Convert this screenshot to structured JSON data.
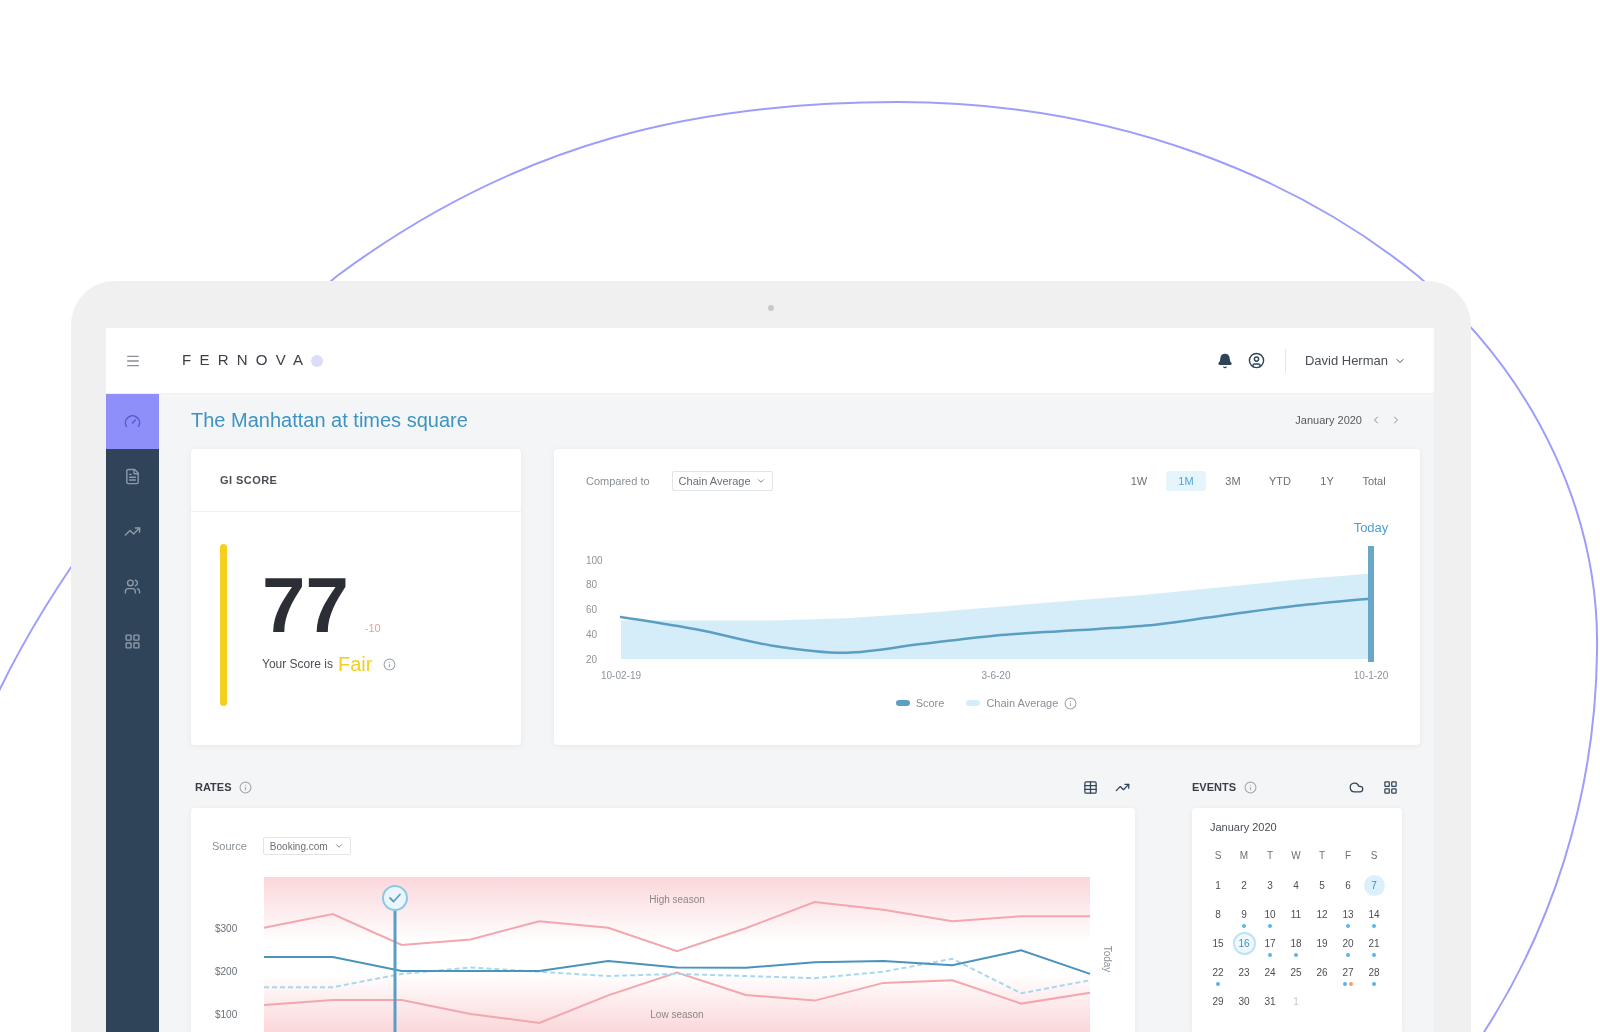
{
  "header": {
    "logo": "FERNOVA",
    "user_name": "David Herman"
  },
  "sidebar": {
    "items": [
      {
        "selected": true
      },
      {
        "selected": false
      },
      {
        "selected": false
      },
      {
        "selected": false
      },
      {
        "selected": false
      }
    ]
  },
  "page": {
    "title": "The Manhattan at times square",
    "period": "January 2020"
  },
  "score_card": {
    "title": "GI SCORE",
    "score": "77",
    "change": "-10",
    "negative": true,
    "caption": "Your Score is",
    "rating": "Fair",
    "color": "#f5cf1f"
  },
  "trend_chart": {
    "compare_label": "Compared to",
    "compare_value": "Chain Average",
    "ranges": [
      {
        "label": "1W",
        "selected": false
      },
      {
        "label": "1M",
        "selected": true
      },
      {
        "label": "3M",
        "selected": false
      },
      {
        "label": "YTD",
        "selected": false
      },
      {
        "label": "1Y",
        "selected": false
      },
      {
        "label": "Total",
        "selected": false
      }
    ],
    "chart_data": {
      "type": "area",
      "categories": [
        "10-02-19",
        null,
        null,
        null,
        null,
        "3-6-20",
        null,
        null,
        null,
        null,
        "10-1-20"
      ],
      "ylim": [
        20,
        100
      ],
      "yticks": [
        {
          "value": 20,
          "label": "20"
        },
        {
          "value": 40,
          "label": "40"
        },
        {
          "value": 60,
          "label": "60"
        },
        {
          "value": 80,
          "label": "80"
        },
        {
          "value": 100,
          "label": "100"
        }
      ],
      "series": [
        {
          "name": "Score",
          "type": "line",
          "color": "#5b9ec3",
          "values": [
            54,
            44,
            31,
            25,
            32,
            39,
            43,
            47,
            55,
            63,
            69
          ]
        },
        {
          "name": "Chain Average",
          "color": "#d4edf9",
          "values": [
            51,
            51,
            51,
            53,
            57,
            62,
            67,
            72,
            78,
            84,
            89
          ]
        }
      ],
      "ref_lines": [
        {
          "axis": "x",
          "value": "10-1-20",
          "label": "Today"
        }
      ]
    }
  },
  "rates": {
    "title": "RATES",
    "source_label": "Source",
    "source_value": "Booking.com",
    "chart_data": {
      "type": "line",
      "ylim": [
        60,
        420
      ],
      "yticks": [
        {
          "value": 100,
          "label": "$100"
        },
        {
          "value": 200,
          "label": "$200"
        },
        {
          "value": 300,
          "label": "$300"
        }
      ],
      "series": [
        {
          "color": "#f3a6ad",
          "values": [
            302,
            334,
            262,
            275,
            317,
            302,
            248,
            301,
            362,
            344,
            317,
            329,
            329
          ]
        },
        {
          "color": "#f3a6ad",
          "values": [
            123,
            134,
            134,
            102,
            81,
            145,
            198,
            146,
            133,
            174,
            180,
            126,
            151
          ]
        },
        {
          "color": "#a9d8ee",
          "line_style": "dashed",
          "values": [
            164,
            164,
            195,
            210,
            200,
            190,
            195,
            190,
            185,
            200,
            230,
            150,
            180
          ]
        },
        {
          "color": "#4a93ba",
          "values": [
            234,
            234,
            202,
            202,
            202,
            225,
            210,
            209,
            222,
            225,
            215,
            250,
            195
          ]
        }
      ],
      "annotations": [
        "High season",
        "Low season"
      ]
    },
    "side_label": "Today"
  },
  "events": {
    "title": "EVENTS",
    "calendar": {
      "month": "January 2020",
      "weekdays": [
        "S",
        "M",
        "T",
        "W",
        "T",
        "F",
        "S"
      ],
      "days": [
        {
          "label": "1",
          "selected": false,
          "today": false,
          "muted": false
        },
        {
          "label": "2",
          "selected": false,
          "today": false,
          "muted": false
        },
        {
          "label": "3",
          "selected": false,
          "today": false,
          "muted": false
        },
        {
          "label": "4",
          "selected": false,
          "today": false,
          "muted": false
        },
        {
          "label": "5",
          "selected": false,
          "today": false,
          "muted": false
        },
        {
          "label": "6",
          "selected": false,
          "today": false,
          "muted": false
        },
        {
          "label": "7",
          "selected": false,
          "today": true,
          "muted": false
        },
        {
          "label": "8",
          "selected": false,
          "today": false,
          "muted": false
        },
        {
          "label": "9",
          "selected": false,
          "today": false,
          "muted": false,
          "dots": [
            {
              "color": "#5ab4e5"
            }
          ]
        },
        {
          "label": "10",
          "selected": false,
          "today": false,
          "muted": false,
          "dots": [
            {
              "color": "#5ab4e5"
            }
          ]
        },
        {
          "label": "11",
          "selected": false,
          "today": false,
          "muted": false
        },
        {
          "label": "12",
          "selected": false,
          "today": false,
          "muted": false
        },
        {
          "label": "13",
          "selected": false,
          "today": false,
          "muted": false,
          "dots": [
            {
              "color": "#5ab4e5"
            }
          ]
        },
        {
          "label": "14",
          "selected": false,
          "today": false,
          "muted": false,
          "dots": [
            {
              "color": "#5ab4e5"
            }
          ]
        },
        {
          "label": "15",
          "selected": false,
          "today": false,
          "muted": false
        },
        {
          "label": "16",
          "selected": true,
          "today": false,
          "muted": false
        },
        {
          "label": "17",
          "selected": false,
          "today": false,
          "muted": false,
          "dots": [
            {
              "color": "#5ab4e5"
            }
          ]
        },
        {
          "label": "18",
          "selected": false,
          "today": false,
          "muted": false,
          "dots": [
            {
              "color": "#5ab4e5"
            }
          ]
        },
        {
          "label": "19",
          "selected": false,
          "today": false,
          "muted": false
        },
        {
          "label": "20",
          "selected": false,
          "today": false,
          "muted": false,
          "dots": [
            {
              "color": "#5ab4e5"
            }
          ]
        },
        {
          "label": "21",
          "selected": false,
          "today": false,
          "muted": false,
          "dots": [
            {
              "color": "#5ab4e5"
            }
          ]
        },
        {
          "label": "22",
          "selected": false,
          "today": false,
          "muted": false,
          "dots": [
            {
              "color": "#5ab4e5"
            }
          ]
        },
        {
          "label": "23",
          "selected": false,
          "today": false,
          "muted": false
        },
        {
          "label": "24",
          "selected": false,
          "today": false,
          "muted": false
        },
        {
          "label": "25",
          "selected": false,
          "today": false,
          "muted": false
        },
        {
          "label": "26",
          "selected": false,
          "today": false,
          "muted": false
        },
        {
          "label": "27",
          "selected": false,
          "today": false,
          "muted": false,
          "dots": [
            {
              "color": "#5ab4e5"
            },
            {
              "color": "#f6a15a"
            }
          ]
        },
        {
          "label": "28",
          "selected": false,
          "today": false,
          "muted": false,
          "dots": [
            {
              "color": "#5ab4e5"
            }
          ]
        },
        {
          "label": "29",
          "selected": false,
          "today": false,
          "muted": false
        },
        {
          "label": "30",
          "selected": false,
          "today": false,
          "muted": false
        },
        {
          "label": "31",
          "selected": false,
          "today": false,
          "muted": false
        },
        {
          "label": "1",
          "selected": false,
          "today": false,
          "muted": true
        }
      ]
    }
  }
}
